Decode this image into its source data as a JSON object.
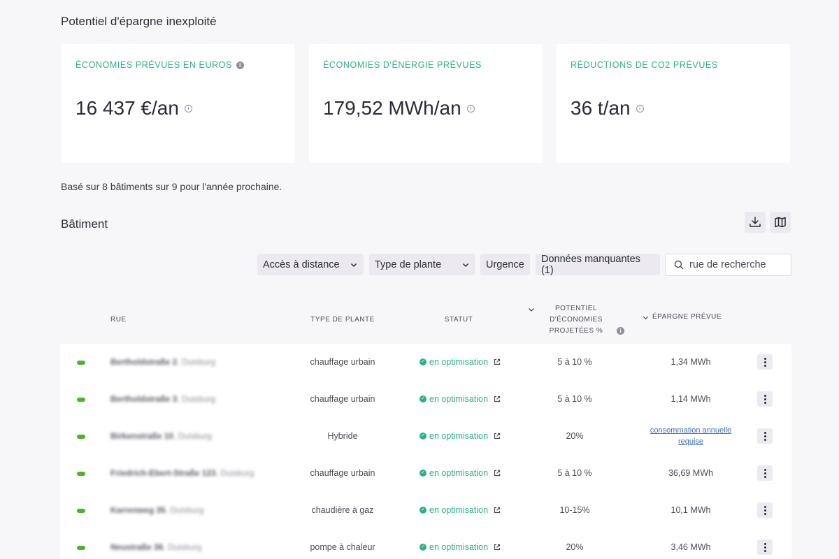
{
  "page": {
    "section_title": "Potentiel d'épargne inexploité",
    "based_on": "Basé sur 8 bâtiments sur 9 pour l'année prochaine.",
    "batiment_title": "Bâtiment"
  },
  "cards": [
    {
      "label": "ÉCONOMIES PRÉVUES EN EUROS",
      "value": "16 437 €/an"
    },
    {
      "label": "ÉCONOMIES D'ÉNERGIE PRÉVUES",
      "value": "179,52 MWh/an"
    },
    {
      "label": "RÉDUCTIONS DE CO2 PRÉVUES",
      "value": "36 t/an"
    }
  ],
  "toolbar": {
    "download_icon": "download-icon",
    "map_icon": "map-icon"
  },
  "filters": {
    "remote_access": "Accès à distance",
    "plant_type": "Type de plante",
    "urgency": "Urgence",
    "missing_data": "Données manquantes (1)",
    "search_placeholder": "rue de recherche"
  },
  "table": {
    "headers": {
      "street": "RUE",
      "plant_type": "TYPE DE PLANTE",
      "status": "STATUT",
      "potential_l1": "POTENTIEL",
      "potential_l2": "D'ÉCONOMIES",
      "potential_l3": "PROJETÉES %",
      "saving": "ÉPARGNE PRÉVUE"
    },
    "rows": [
      {
        "street": "Bertholdstraße 2",
        "city": ", Duisburg",
        "plant": "chauffage urbain",
        "status": "en optimisation",
        "potential": "5 à 10 %",
        "saving": "1,34 MWh"
      },
      {
        "street": "Bertholdstraße 3",
        "city": ", Duisburg",
        "plant": "chauffage urbain",
        "status": "en optimisation",
        "potential": "5 à 10 %",
        "saving": "1,14 MWh"
      },
      {
        "street": "Birkenstraße 10",
        "city": ", Duisburg",
        "plant": "Hybride",
        "status": "en optimisation",
        "potential": "20%",
        "saving": "consommation annuelle requise"
      },
      {
        "street": "Friedrich-Ebert-Straße 123",
        "city": ", Duisburg",
        "plant": "chauffage urbain",
        "status": "en optimisation",
        "potential": "5 à 10 %",
        "saving": "36,69 MWh"
      },
      {
        "street": "Karrenweg 35",
        "city": ", Duisburg",
        "plant": "chaudière à gaz",
        "status": "en optimisation",
        "potential": "10-15%",
        "saving": "10,1 MWh"
      },
      {
        "street": "Neustraße 36",
        "city": ", Duisburg",
        "plant": "pompe à chaleur",
        "status": "en optimisation",
        "potential": "20%",
        "saving": "3,46 MWh"
      }
    ]
  },
  "colors": {
    "accent": "#2bb08c",
    "status_dot": "#4db32a",
    "link": "#3d6fc7"
  }
}
